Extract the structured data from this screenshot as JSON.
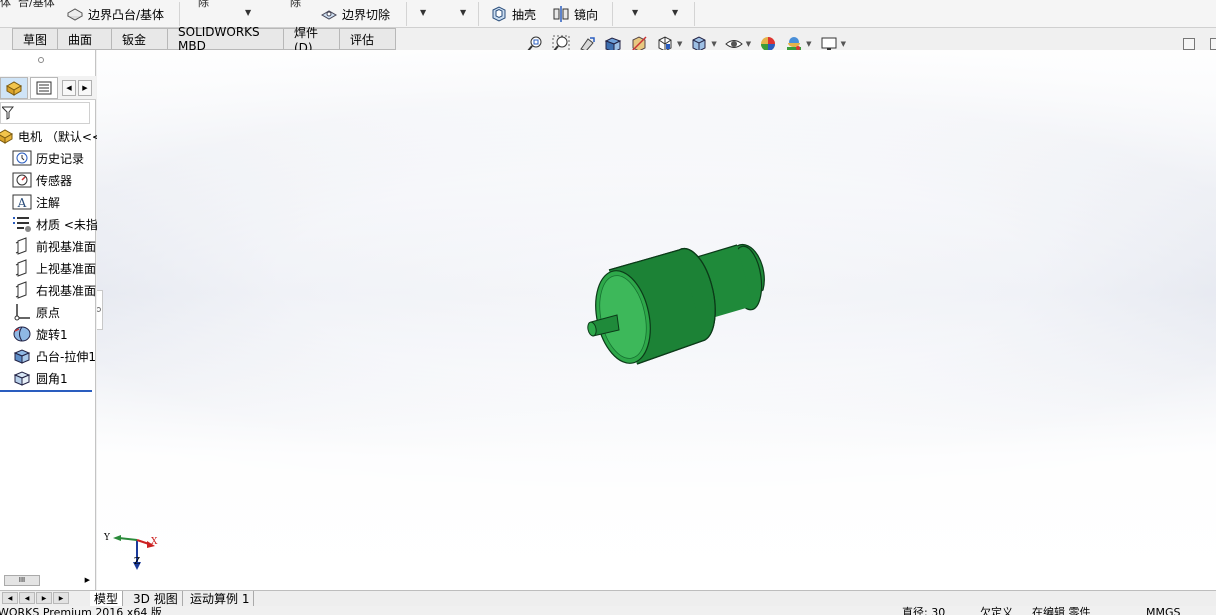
{
  "ribbon": {
    "top_cut_label": "合/基体",
    "top_cut_left": "体",
    "boundary_boss_label": "边界凸台/基体",
    "cut_a": "除",
    "cut_b": "除",
    "boundary_cut_label": "边界切除",
    "shell_label": "抽壳",
    "mirror_label": "镜向"
  },
  "tabs": [
    "草图",
    "曲面",
    "钣金",
    "SOLIDWORKS MBD",
    "焊件(D)",
    "评估"
  ],
  "tree": {
    "root_label": "电机 （默认<<",
    "items": [
      {
        "label": "历史记录",
        "icon": "history-icon"
      },
      {
        "label": "传感器",
        "icon": "sensor-icon"
      },
      {
        "label": "注解",
        "icon": "annotation-icon"
      },
      {
        "label": "材质 <未指",
        "icon": "material-icon"
      },
      {
        "label": "前视基准面",
        "icon": "plane-icon"
      },
      {
        "label": "上视基准面",
        "icon": "plane-icon"
      },
      {
        "label": "右视基准面",
        "icon": "plane-icon"
      },
      {
        "label": "原点",
        "icon": "origin-icon"
      },
      {
        "label": "旋转1",
        "icon": "revolve-icon"
      },
      {
        "label": "凸台-拉伸1",
        "icon": "extrude-icon"
      },
      {
        "label": "圆角1",
        "icon": "fillet-icon"
      }
    ]
  },
  "triad": {
    "x": "X",
    "y": "Y",
    "z": "Z"
  },
  "bottom_tabs": [
    "模型",
    "3D 视图",
    "运动算例 1"
  ],
  "status": {
    "app": "WORKS Premium 2016 x64 版",
    "diameter": "直径: 30",
    "defined": "欠定义",
    "editing": "在编辑 零件",
    "units": "MMGS"
  },
  "colors": {
    "accent": "#2a5dbf",
    "part_green": "#1f8a3a"
  }
}
